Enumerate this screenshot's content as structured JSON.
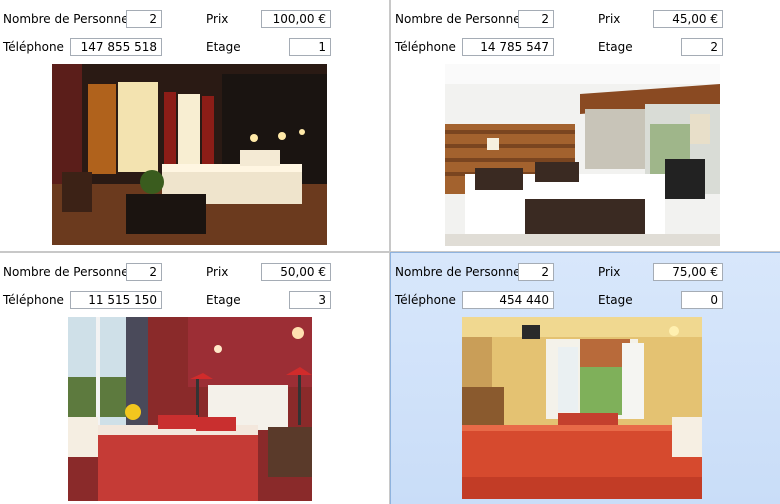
{
  "labels": {
    "persons": "Nombre de Personne",
    "price": "Prix",
    "phone": "Téléphone",
    "floor": "Etage"
  },
  "rooms": [
    {
      "persons": "2",
      "price": "100,00 €",
      "phone": "147 855 518",
      "floor": "1",
      "photo": "dark-luxury-hotel-room"
    },
    {
      "persons": "2",
      "price": "45,00 €",
      "phone": "14 785 547",
      "floor": "2",
      "photo": "modern-wood-twin-room"
    },
    {
      "persons": "2",
      "price": "50,00 €",
      "phone": "11 515 150",
      "floor": "3",
      "photo": "red-classic-bedroom"
    },
    {
      "persons": "2",
      "price": "75,00 €",
      "phone": "454 440",
      "floor": "0",
      "photo": "yellow-sunny-room"
    }
  ],
  "selected_index": 3
}
